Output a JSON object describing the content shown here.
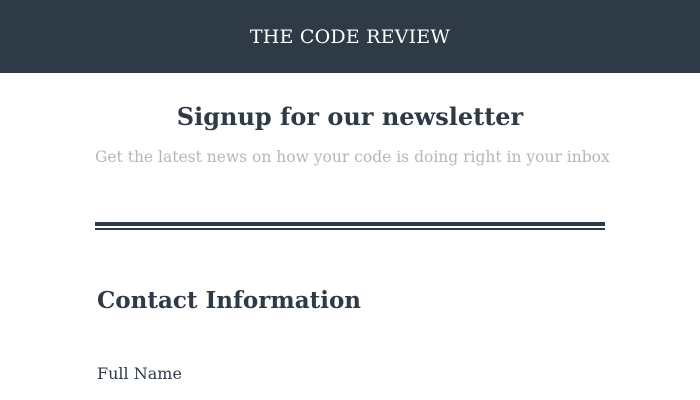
{
  "header": {
    "brand": "THE CODE REVIEW"
  },
  "hero": {
    "title": "Signup for our newsletter",
    "subtitle": "Get the latest news on how your code is doing right in your inbox"
  },
  "form": {
    "section_title": "Contact Information",
    "fields": [
      {
        "label": "Full Name"
      }
    ]
  },
  "colors": {
    "header_bg": "#2e3a46",
    "text": "#2e3a46",
    "muted_text": "#b6b6b6",
    "background": "#ffffff"
  }
}
